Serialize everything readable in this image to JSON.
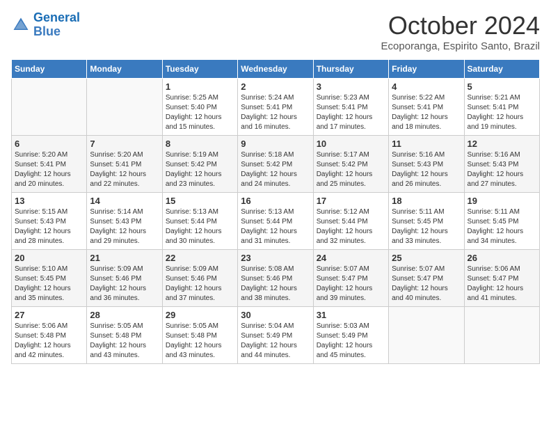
{
  "header": {
    "logo_line1": "General",
    "logo_line2": "Blue",
    "month": "October 2024",
    "location": "Ecoporanga, Espirito Santo, Brazil"
  },
  "days_of_week": [
    "Sunday",
    "Monday",
    "Tuesday",
    "Wednesday",
    "Thursday",
    "Friday",
    "Saturday"
  ],
  "weeks": [
    [
      {
        "day": "",
        "sunrise": "",
        "sunset": "",
        "daylight": ""
      },
      {
        "day": "",
        "sunrise": "",
        "sunset": "",
        "daylight": ""
      },
      {
        "day": "1",
        "sunrise": "Sunrise: 5:25 AM",
        "sunset": "Sunset: 5:40 PM",
        "daylight": "Daylight: 12 hours and 15 minutes."
      },
      {
        "day": "2",
        "sunrise": "Sunrise: 5:24 AM",
        "sunset": "Sunset: 5:41 PM",
        "daylight": "Daylight: 12 hours and 16 minutes."
      },
      {
        "day": "3",
        "sunrise": "Sunrise: 5:23 AM",
        "sunset": "Sunset: 5:41 PM",
        "daylight": "Daylight: 12 hours and 17 minutes."
      },
      {
        "day": "4",
        "sunrise": "Sunrise: 5:22 AM",
        "sunset": "Sunset: 5:41 PM",
        "daylight": "Daylight: 12 hours and 18 minutes."
      },
      {
        "day": "5",
        "sunrise": "Sunrise: 5:21 AM",
        "sunset": "Sunset: 5:41 PM",
        "daylight": "Daylight: 12 hours and 19 minutes."
      }
    ],
    [
      {
        "day": "6",
        "sunrise": "Sunrise: 5:20 AM",
        "sunset": "Sunset: 5:41 PM",
        "daylight": "Daylight: 12 hours and 20 minutes."
      },
      {
        "day": "7",
        "sunrise": "Sunrise: 5:20 AM",
        "sunset": "Sunset: 5:41 PM",
        "daylight": "Daylight: 12 hours and 22 minutes."
      },
      {
        "day": "8",
        "sunrise": "Sunrise: 5:19 AM",
        "sunset": "Sunset: 5:42 PM",
        "daylight": "Daylight: 12 hours and 23 minutes."
      },
      {
        "day": "9",
        "sunrise": "Sunrise: 5:18 AM",
        "sunset": "Sunset: 5:42 PM",
        "daylight": "Daylight: 12 hours and 24 minutes."
      },
      {
        "day": "10",
        "sunrise": "Sunrise: 5:17 AM",
        "sunset": "Sunset: 5:42 PM",
        "daylight": "Daylight: 12 hours and 25 minutes."
      },
      {
        "day": "11",
        "sunrise": "Sunrise: 5:16 AM",
        "sunset": "Sunset: 5:43 PM",
        "daylight": "Daylight: 12 hours and 26 minutes."
      },
      {
        "day": "12",
        "sunrise": "Sunrise: 5:16 AM",
        "sunset": "Sunset: 5:43 PM",
        "daylight": "Daylight: 12 hours and 27 minutes."
      }
    ],
    [
      {
        "day": "13",
        "sunrise": "Sunrise: 5:15 AM",
        "sunset": "Sunset: 5:43 PM",
        "daylight": "Daylight: 12 hours and 28 minutes."
      },
      {
        "day": "14",
        "sunrise": "Sunrise: 5:14 AM",
        "sunset": "Sunset: 5:43 PM",
        "daylight": "Daylight: 12 hours and 29 minutes."
      },
      {
        "day": "15",
        "sunrise": "Sunrise: 5:13 AM",
        "sunset": "Sunset: 5:44 PM",
        "daylight": "Daylight: 12 hours and 30 minutes."
      },
      {
        "day": "16",
        "sunrise": "Sunrise: 5:13 AM",
        "sunset": "Sunset: 5:44 PM",
        "daylight": "Daylight: 12 hours and 31 minutes."
      },
      {
        "day": "17",
        "sunrise": "Sunrise: 5:12 AM",
        "sunset": "Sunset: 5:44 PM",
        "daylight": "Daylight: 12 hours and 32 minutes."
      },
      {
        "day": "18",
        "sunrise": "Sunrise: 5:11 AM",
        "sunset": "Sunset: 5:45 PM",
        "daylight": "Daylight: 12 hours and 33 minutes."
      },
      {
        "day": "19",
        "sunrise": "Sunrise: 5:11 AM",
        "sunset": "Sunset: 5:45 PM",
        "daylight": "Daylight: 12 hours and 34 minutes."
      }
    ],
    [
      {
        "day": "20",
        "sunrise": "Sunrise: 5:10 AM",
        "sunset": "Sunset: 5:45 PM",
        "daylight": "Daylight: 12 hours and 35 minutes."
      },
      {
        "day": "21",
        "sunrise": "Sunrise: 5:09 AM",
        "sunset": "Sunset: 5:46 PM",
        "daylight": "Daylight: 12 hours and 36 minutes."
      },
      {
        "day": "22",
        "sunrise": "Sunrise: 5:09 AM",
        "sunset": "Sunset: 5:46 PM",
        "daylight": "Daylight: 12 hours and 37 minutes."
      },
      {
        "day": "23",
        "sunrise": "Sunrise: 5:08 AM",
        "sunset": "Sunset: 5:46 PM",
        "daylight": "Daylight: 12 hours and 38 minutes."
      },
      {
        "day": "24",
        "sunrise": "Sunrise: 5:07 AM",
        "sunset": "Sunset: 5:47 PM",
        "daylight": "Daylight: 12 hours and 39 minutes."
      },
      {
        "day": "25",
        "sunrise": "Sunrise: 5:07 AM",
        "sunset": "Sunset: 5:47 PM",
        "daylight": "Daylight: 12 hours and 40 minutes."
      },
      {
        "day": "26",
        "sunrise": "Sunrise: 5:06 AM",
        "sunset": "Sunset: 5:47 PM",
        "daylight": "Daylight: 12 hours and 41 minutes."
      }
    ],
    [
      {
        "day": "27",
        "sunrise": "Sunrise: 5:06 AM",
        "sunset": "Sunset: 5:48 PM",
        "daylight": "Daylight: 12 hours and 42 minutes."
      },
      {
        "day": "28",
        "sunrise": "Sunrise: 5:05 AM",
        "sunset": "Sunset: 5:48 PM",
        "daylight": "Daylight: 12 hours and 43 minutes."
      },
      {
        "day": "29",
        "sunrise": "Sunrise: 5:05 AM",
        "sunset": "Sunset: 5:48 PM",
        "daylight": "Daylight: 12 hours and 43 minutes."
      },
      {
        "day": "30",
        "sunrise": "Sunrise: 5:04 AM",
        "sunset": "Sunset: 5:49 PM",
        "daylight": "Daylight: 12 hours and 44 minutes."
      },
      {
        "day": "31",
        "sunrise": "Sunrise: 5:03 AM",
        "sunset": "Sunset: 5:49 PM",
        "daylight": "Daylight: 12 hours and 45 minutes."
      },
      {
        "day": "",
        "sunrise": "",
        "sunset": "",
        "daylight": ""
      },
      {
        "day": "",
        "sunrise": "",
        "sunset": "",
        "daylight": ""
      }
    ]
  ]
}
